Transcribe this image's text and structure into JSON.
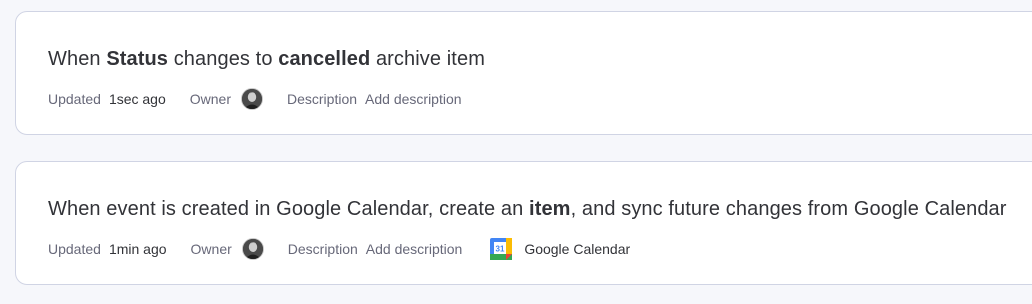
{
  "automations": [
    {
      "title": {
        "t1": "When ",
        "b1": "Status",
        "t2": " changes to ",
        "b2": "cancelled",
        "t3": " archive item"
      },
      "meta": {
        "updated_label": "Updated",
        "updated_value": "1sec ago",
        "owner_label": "Owner",
        "description_label": "Description",
        "description_placeholder": "Add description"
      }
    },
    {
      "title": {
        "t1": "When event is created in Google Calendar, create an ",
        "b1": "item",
        "t2": ", and sync future changes from Google Calendar"
      },
      "meta": {
        "updated_label": "Updated",
        "updated_value": "1min ago",
        "owner_label": "Owner",
        "description_label": "Description",
        "description_placeholder": "Add description",
        "integration_name": "Google Calendar",
        "integration_icon": "google-calendar-icon",
        "integration_icon_day": "31"
      }
    }
  ],
  "colors": {
    "card_border": "#d0d4e4",
    "muted_text": "#676879",
    "text": "#323338",
    "gcal_blue": "#4285f4",
    "gcal_green": "#34a853",
    "gcal_yellow": "#fbbc04",
    "gcal_red": "#ea4335"
  }
}
